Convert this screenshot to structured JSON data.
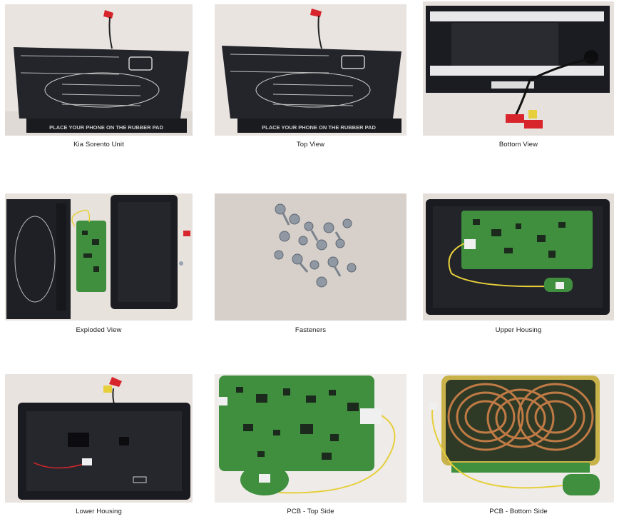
{
  "gallery": {
    "items": [
      {
        "caption": "Kia Sorento Unit",
        "pad_text": "PLACE YOUR PHONE ON THE RUBBER PAD",
        "icon": "wireless-charger-photo"
      },
      {
        "caption": "Top View",
        "pad_text": "PLACE YOUR PHONE ON THE RUBBER PAD",
        "icon": "top-view-photo"
      },
      {
        "caption": "Bottom View",
        "icon": "bottom-view-photo"
      },
      {
        "caption": "Exploded View",
        "icon": "exploded-view-photo"
      },
      {
        "caption": "Fasteners",
        "icon": "fasteners-photo"
      },
      {
        "caption": "Upper Housing",
        "icon": "upper-housing-photo"
      },
      {
        "caption": "Lower Housing",
        "icon": "lower-housing-photo"
      },
      {
        "caption": "PCB - Top Side",
        "icon": "pcb-top-photo"
      },
      {
        "caption": "PCB - Bottom Side",
        "icon": "pcb-bottom-photo"
      }
    ]
  },
  "colors": {
    "background": "#ffffff",
    "caption_text": "#1a1a1a",
    "housing_black": "#1c1d22",
    "pcb_green": "#3f8f3e",
    "coil_copper": "#c07a45",
    "wire_red": "#d8252c",
    "wire_yellow": "#e6cf3a"
  }
}
